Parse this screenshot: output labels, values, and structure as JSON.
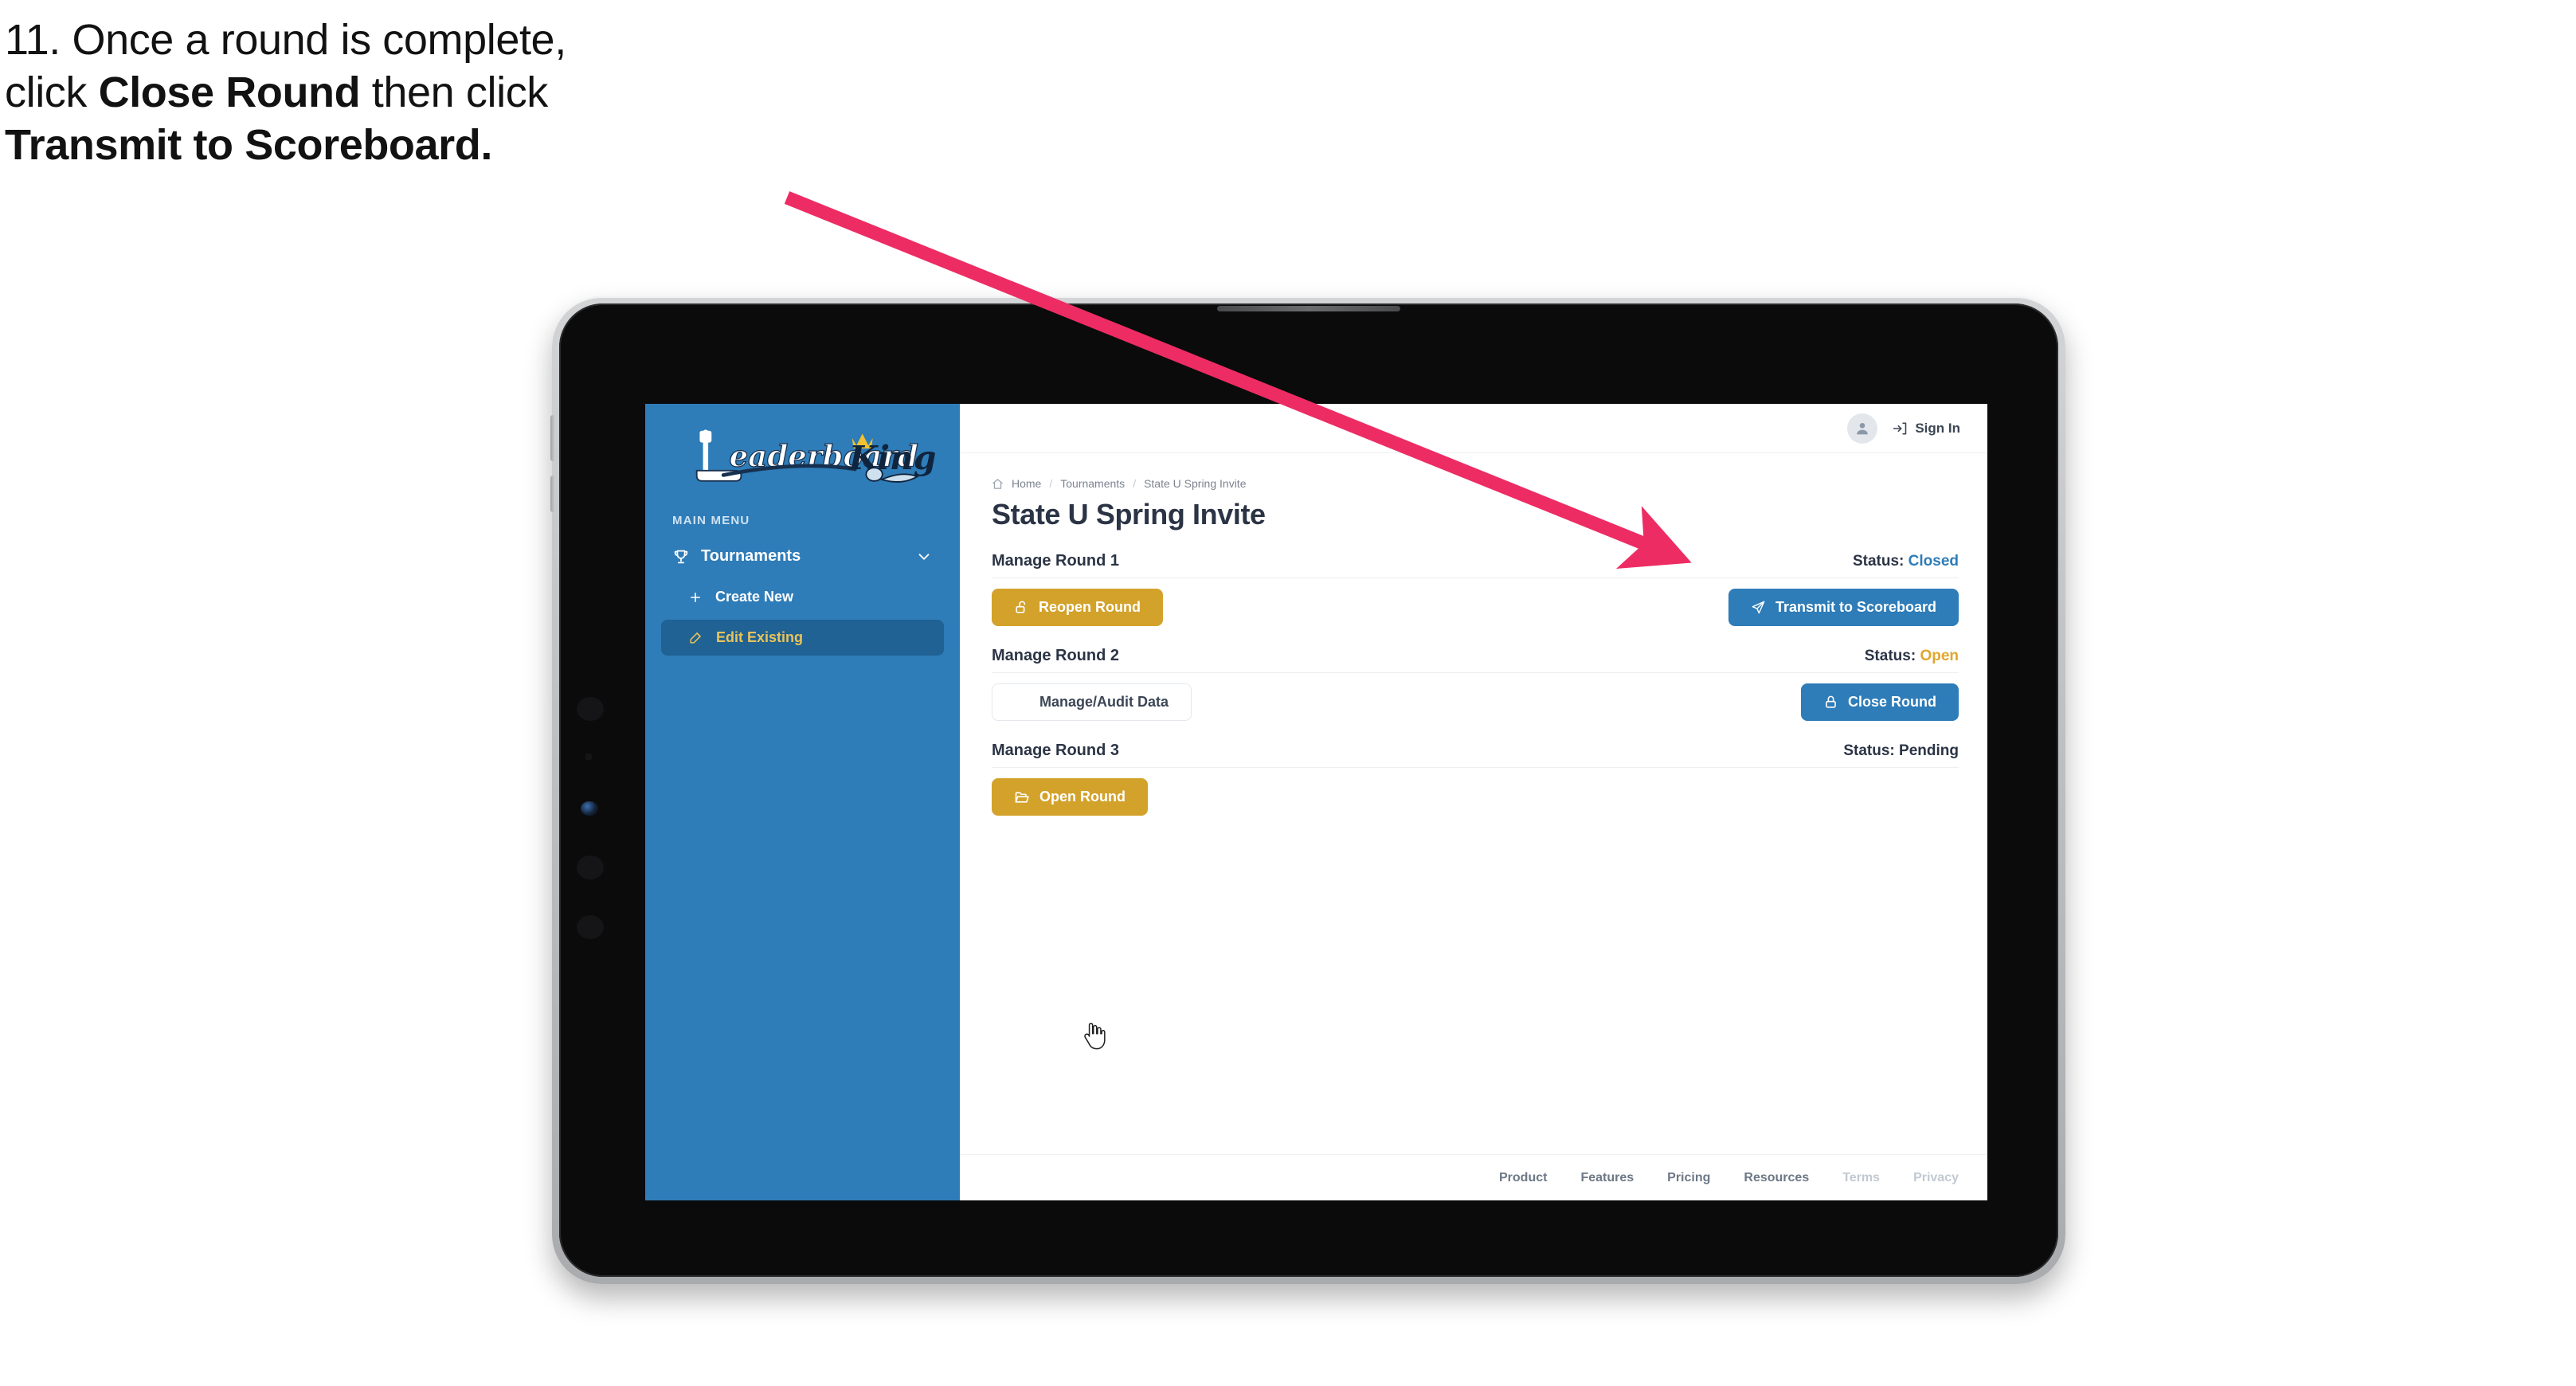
{
  "caption": {
    "line1": "11. Once a round is complete,",
    "line2_pre": "click ",
    "line2_bold": "Close Round",
    "line2_post": " then click",
    "line3_bold": "Transmit to Scoreboard."
  },
  "annotation": {
    "arrow_color": "#ED2C64"
  },
  "colors": {
    "sidebar_blue": "#2E7CB8",
    "sidebar_active": "#1F6293",
    "gold": "#D3A22B",
    "status_open": "#E0A62E",
    "status_closed": "#2E7CB8",
    "text_dark": "#2B3445"
  },
  "sidebar": {
    "logo_primary": "Leaderboard",
    "logo_secondary": "King",
    "menu_label": "MAIN MENU",
    "nav": {
      "label": "Tournaments",
      "icon": "trophy-icon",
      "chevron": "chevron-down-icon"
    },
    "items": [
      {
        "label": "Create New",
        "icon": "plus-icon",
        "active": false
      },
      {
        "label": "Edit Existing",
        "icon": "pencil-square-icon",
        "active": true
      }
    ]
  },
  "topbar": {
    "avatar_icon": "user-avatar-icon",
    "signin_label": "Sign In",
    "signin_icon": "sign-in-arrow-icon"
  },
  "breadcrumb": {
    "home_icon": "home-icon",
    "items": [
      "Home",
      "Tournaments",
      "State U Spring Invite"
    ],
    "separator": "/"
  },
  "page": {
    "title": "State U Spring Invite"
  },
  "rounds": [
    {
      "title": "Manage Round 1",
      "status_label": "Status:",
      "status_value": "Closed",
      "status_kind": "closed",
      "left_button": {
        "label": "Reopen Round",
        "icon": "unlock-icon",
        "style": "gold"
      },
      "right_button": {
        "label": "Transmit to Scoreboard",
        "icon": "send-icon",
        "style": "blue"
      }
    },
    {
      "title": "Manage Round 2",
      "status_label": "Status:",
      "status_value": "Open",
      "status_kind": "open",
      "left_button": {
        "label": "Manage/Audit Data",
        "icon": "table-grid-icon",
        "style": "ghost"
      },
      "right_button": {
        "label": "Close Round",
        "icon": "lock-icon",
        "style": "blue"
      }
    },
    {
      "title": "Manage Round 3",
      "status_label": "Status:",
      "status_value": "Pending",
      "status_kind": "plain",
      "left_button": {
        "label": "Open Round",
        "icon": "folder-open-icon",
        "style": "gold"
      },
      "right_button": null
    }
  ],
  "footer": {
    "links": [
      {
        "label": "Product",
        "dim": false
      },
      {
        "label": "Features",
        "dim": false
      },
      {
        "label": "Pricing",
        "dim": false
      },
      {
        "label": "Resources",
        "dim": false
      },
      {
        "label": "Terms",
        "dim": true
      },
      {
        "label": "Privacy",
        "dim": true
      }
    ]
  }
}
